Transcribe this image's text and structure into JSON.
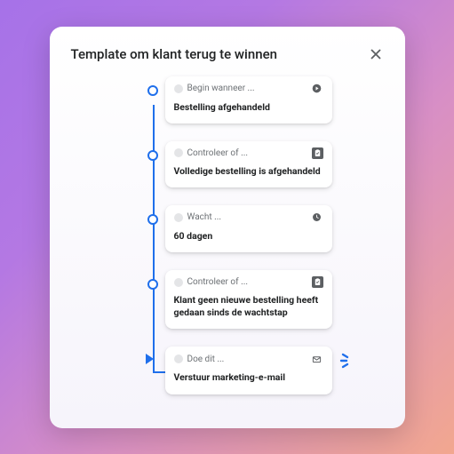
{
  "header": {
    "title": "Template om klant terug te winnen"
  },
  "steps": [
    {
      "label": "Begin wanneer ...",
      "body": "Bestelling afgehandeld",
      "icon": "play"
    },
    {
      "label": "Controleer of ...",
      "body": "Volledige bestelling is afgehandeld",
      "icon": "clipboard"
    },
    {
      "label": "Wacht ...",
      "body": "60 dagen",
      "icon": "clock"
    },
    {
      "label": "Controleer of ...",
      "body": "Klant geen nieuwe bestelling heeft gedaan sinds de wachtstap",
      "icon": "clipboard"
    },
    {
      "label": "Doe dit ...",
      "body": "Verstuur marketing-e-mail",
      "icon": "mail"
    }
  ],
  "colors": {
    "accent": "#1f6feb"
  }
}
